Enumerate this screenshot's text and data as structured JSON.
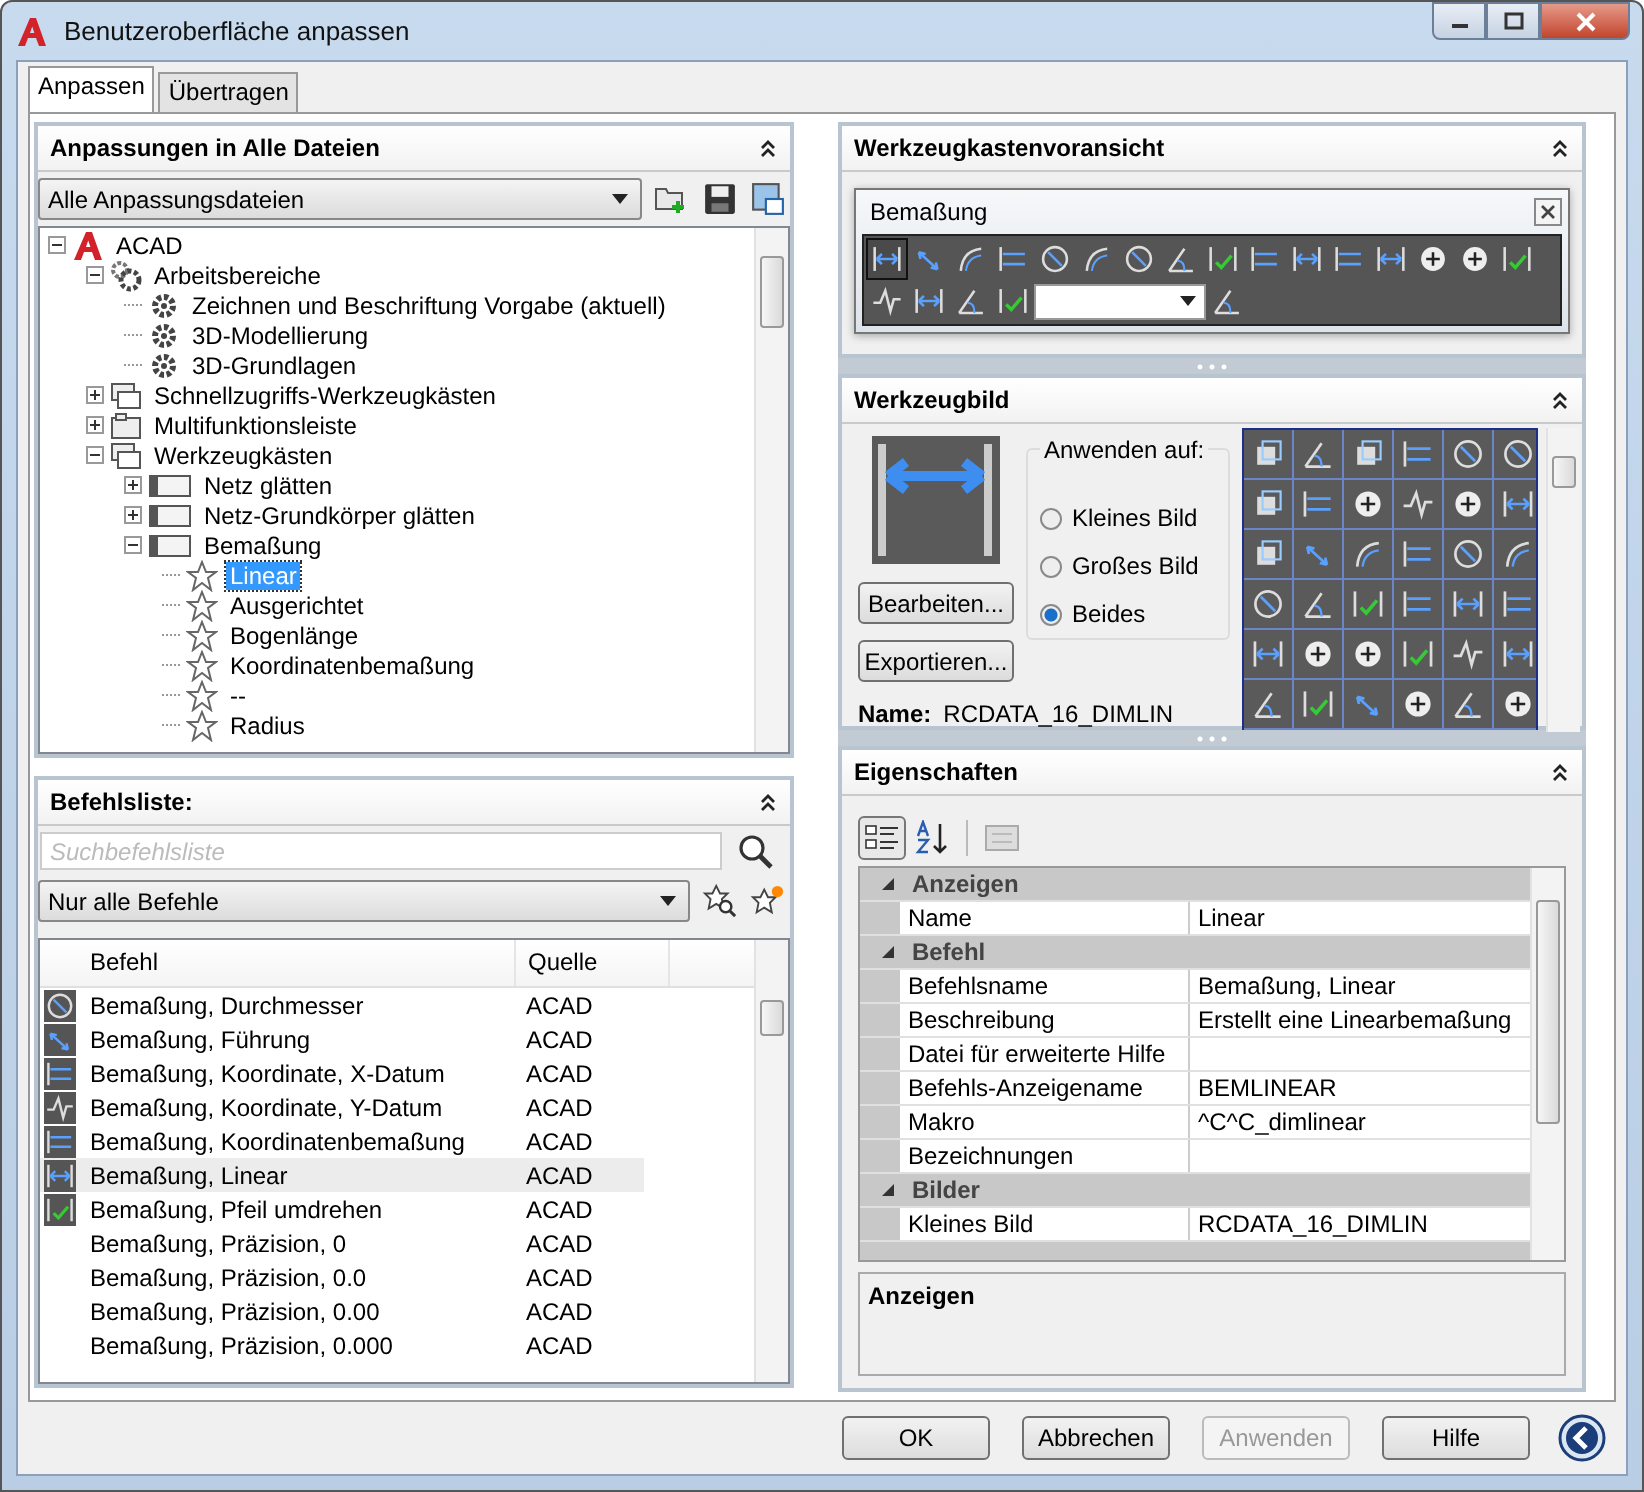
{
  "window": {
    "title": "Benutzeroberfläche anpassen"
  },
  "tabs": [
    {
      "label": "Anpassen",
      "selected": true
    },
    {
      "label": "Übertragen",
      "selected": false
    }
  ],
  "customizations": {
    "title": "Anpassungen in Alle Dateien",
    "file_filter": "Alle Anpassungsdateien",
    "tree": [
      {
        "label": "ACAD",
        "kind": "root",
        "expanded": true,
        "selected": false,
        "children": [
          {
            "label": "Arbeitsbereiche",
            "kind": "workspaces",
            "expanded": true,
            "selected": false,
            "children": [
              {
                "label": "Zeichnen und Beschriftung Vorgabe (aktuell)",
                "kind": "workspace",
                "selected": false
              },
              {
                "label": "3D-Modellierung",
                "kind": "workspace",
                "selected": false
              },
              {
                "label": "3D-Grundlagen",
                "kind": "workspace",
                "selected": false
              }
            ]
          },
          {
            "label": "Schnellzugriffs-Werkzeugkästen",
            "kind": "quick-access",
            "expanded": false,
            "selected": false
          },
          {
            "label": "Multifunktionsleiste",
            "kind": "ribbon",
            "expanded": false,
            "selected": false
          },
          {
            "label": "Werkzeugkästen",
            "kind": "toolbars",
            "expanded": true,
            "selected": false,
            "children": [
              {
                "label": "Netz glätten",
                "kind": "toolbar",
                "expanded": false,
                "selected": false
              },
              {
                "label": "Netz-Grundkörper glätten",
                "kind": "toolbar",
                "expanded": false,
                "selected": false
              },
              {
                "label": "Bemaßung",
                "kind": "toolbar",
                "expanded": true,
                "selected": false,
                "children": [
                  {
                    "label": "Linear",
                    "kind": "command",
                    "selected": true
                  },
                  {
                    "label": "Ausgerichtet",
                    "kind": "command",
                    "selected": false
                  },
                  {
                    "label": "Bogenlänge",
                    "kind": "command",
                    "selected": false
                  },
                  {
                    "label": "Koordinatenbemaßung",
                    "kind": "command",
                    "selected": false
                  },
                  {
                    "label": "--",
                    "kind": "command",
                    "selected": false
                  },
                  {
                    "label": "Radius",
                    "kind": "command",
                    "selected": false
                  }
                ]
              }
            ]
          }
        ]
      }
    ]
  },
  "command_list": {
    "title": "Befehlsliste:",
    "search": {
      "placeholder": "Suchbefehlsliste"
    },
    "filter": "Nur alle Befehle",
    "columns": [
      "Befehl",
      "Quelle"
    ],
    "rows": [
      {
        "command": "Bemaßung, Durchmesser",
        "source": "ACAD",
        "kind": "with-icon",
        "selected": false
      },
      {
        "command": "Bemaßung, Führung",
        "source": "ACAD",
        "kind": "with-icon",
        "selected": false
      },
      {
        "command": "Bemaßung, Koordinate, X-Datum",
        "source": "ACAD",
        "kind": "with-icon",
        "selected": false
      },
      {
        "command": "Bemaßung, Koordinate, Y-Datum",
        "source": "ACAD",
        "kind": "with-icon",
        "selected": false
      },
      {
        "command": "Bemaßung, Koordinatenbemaßung",
        "source": "ACAD",
        "kind": "with-icon",
        "selected": false
      },
      {
        "command": "Bemaßung, Linear",
        "source": "ACAD",
        "kind": "with-icon",
        "selected": true
      },
      {
        "command": "Bemaßung, Pfeil umdrehen",
        "source": "ACAD",
        "kind": "with-icon",
        "selected": false
      },
      {
        "command": "Bemaßung, Präzision, 0",
        "source": "ACAD",
        "kind": "plain",
        "selected": false
      },
      {
        "command": "Bemaßung, Präzision, 0.0",
        "source": "ACAD",
        "kind": "plain",
        "selected": false
      },
      {
        "command": "Bemaßung, Präzision, 0.00",
        "source": "ACAD",
        "kind": "plain",
        "selected": false
      },
      {
        "command": "Bemaßung, Präzision, 0.000",
        "source": "ACAD",
        "kind": "plain",
        "selected": false
      }
    ]
  },
  "toolbar_preview": {
    "title": "Werkzeugkastenvoransicht",
    "toolbar_title": "Bemaßung"
  },
  "tool_image": {
    "title": "Werkzeugbild",
    "apply_to": {
      "label": "Anwenden auf:",
      "options": [
        {
          "label": "Kleines Bild",
          "selected": false
        },
        {
          "label": "Großes Bild",
          "selected": false
        },
        {
          "label": "Beides",
          "selected": true
        }
      ]
    },
    "buttons": [
      "Bearbeiten...",
      "Exportieren..."
    ],
    "name_label": "Name:",
    "name_value": "RCDATA_16_DIMLIN"
  },
  "properties": {
    "title": "Eigenschaften",
    "rows": [
      {
        "kind": "category",
        "label": "Anzeigen",
        "expanded": true
      },
      {
        "kind": "property",
        "label": "Name",
        "value": "Linear"
      },
      {
        "kind": "category",
        "label": "Befehl",
        "expanded": true
      },
      {
        "kind": "property",
        "label": "Befehlsname",
        "value": "Bemaßung, Linear"
      },
      {
        "kind": "property",
        "label": "Beschreibung",
        "value": "Erstellt eine Linearbemaßung"
      },
      {
        "kind": "property",
        "label": "Datei für erweiterte Hilfe"
      },
      {
        "kind": "property",
        "label": "Befehls-Anzeigename",
        "value": "BEMLINEAR"
      },
      {
        "kind": "property",
        "label": "Makro",
        "value": "^C^C_dimlinear"
      },
      {
        "kind": "property",
        "label": "Bezeichnungen"
      },
      {
        "kind": "category",
        "label": "Bilder",
        "expanded": true
      },
      {
        "kind": "property",
        "label": "Kleines Bild",
        "value": "RCDATA_16_DIMLIN"
      }
    ],
    "description_title": "Anzeigen"
  },
  "buttons": [
    {
      "label": "OK",
      "disabled": false
    },
    {
      "label": "Abbrechen",
      "disabled": false
    },
    {
      "label": "Anwenden",
      "disabled": true
    },
    {
      "label": "Hilfe",
      "disabled": false
    }
  ]
}
